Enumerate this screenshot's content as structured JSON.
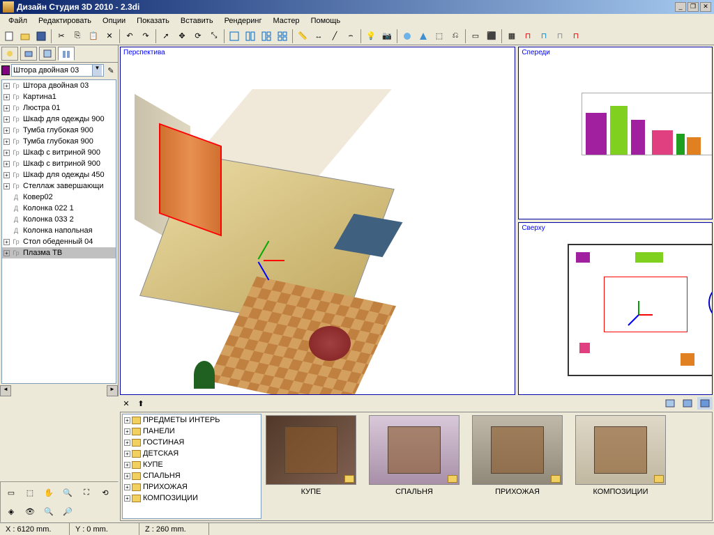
{
  "window": {
    "title": "Дизайн Студия 3D 2010 - 2.3di"
  },
  "menu": [
    "Файл",
    "Редактировать",
    "Опции",
    "Показать",
    "Вставить",
    "Рендеринг",
    "Мастер",
    "Помощь"
  ],
  "selected_object": "Штора двойная 03",
  "scene_tree": [
    {
      "exp": "+",
      "ic": "Гр",
      "label": "Штора двойная 03"
    },
    {
      "exp": "+",
      "ic": "Гр",
      "label": "Картина1"
    },
    {
      "exp": "+",
      "ic": "Гр",
      "label": "Люстра 01"
    },
    {
      "exp": "+",
      "ic": "Гр",
      "label": "Шкаф для одежды 900"
    },
    {
      "exp": "+",
      "ic": "Гр",
      "label": "Тумба глубокая 900"
    },
    {
      "exp": "+",
      "ic": "Гр",
      "label": "Тумба глубокая 900"
    },
    {
      "exp": "+",
      "ic": "Гр",
      "label": "Шкаф с витриной 900"
    },
    {
      "exp": "+",
      "ic": "Гр",
      "label": "Шкаф с витриной 900"
    },
    {
      "exp": "+",
      "ic": "Гр",
      "label": "Шкаф для одежды 450"
    },
    {
      "exp": "+",
      "ic": "Гр",
      "label": "Стеллаж завершающи"
    },
    {
      "exp": "",
      "ic": "Д",
      "label": "Ковер02"
    },
    {
      "exp": "",
      "ic": "Д",
      "label": "Колонка 022 1"
    },
    {
      "exp": "",
      "ic": "Д",
      "label": "Колонка 033 2"
    },
    {
      "exp": "",
      "ic": "Д",
      "label": "Колонка напольная"
    },
    {
      "exp": "+",
      "ic": "Гр",
      "label": "Стол обеденный 04"
    },
    {
      "exp": "+",
      "ic": "Гр",
      "label": "Плазма ТВ",
      "sel": true
    }
  ],
  "viewports": {
    "persp": "Перспектива",
    "front": "Спереди",
    "top": "Сверху"
  },
  "library_tree": [
    "ПРЕДМЕТЫ ИНТЕРЬ",
    "ПАНЕЛИ",
    "ГОСТИНАЯ",
    "ДЕТСКАЯ",
    "КУПЕ",
    "СПАЛЬНЯ",
    "ПРИХОЖАЯ",
    "КОМПОЗИЦИИ"
  ],
  "library_thumbs": [
    "КУПЕ",
    "СПАЛЬНЯ",
    "ПРИХОЖАЯ",
    "КОМПОЗИЦИИ"
  ],
  "status": {
    "x": "X : 6120 mm.",
    "y": "Y : 0 mm.",
    "z": "Z : 260 mm."
  }
}
